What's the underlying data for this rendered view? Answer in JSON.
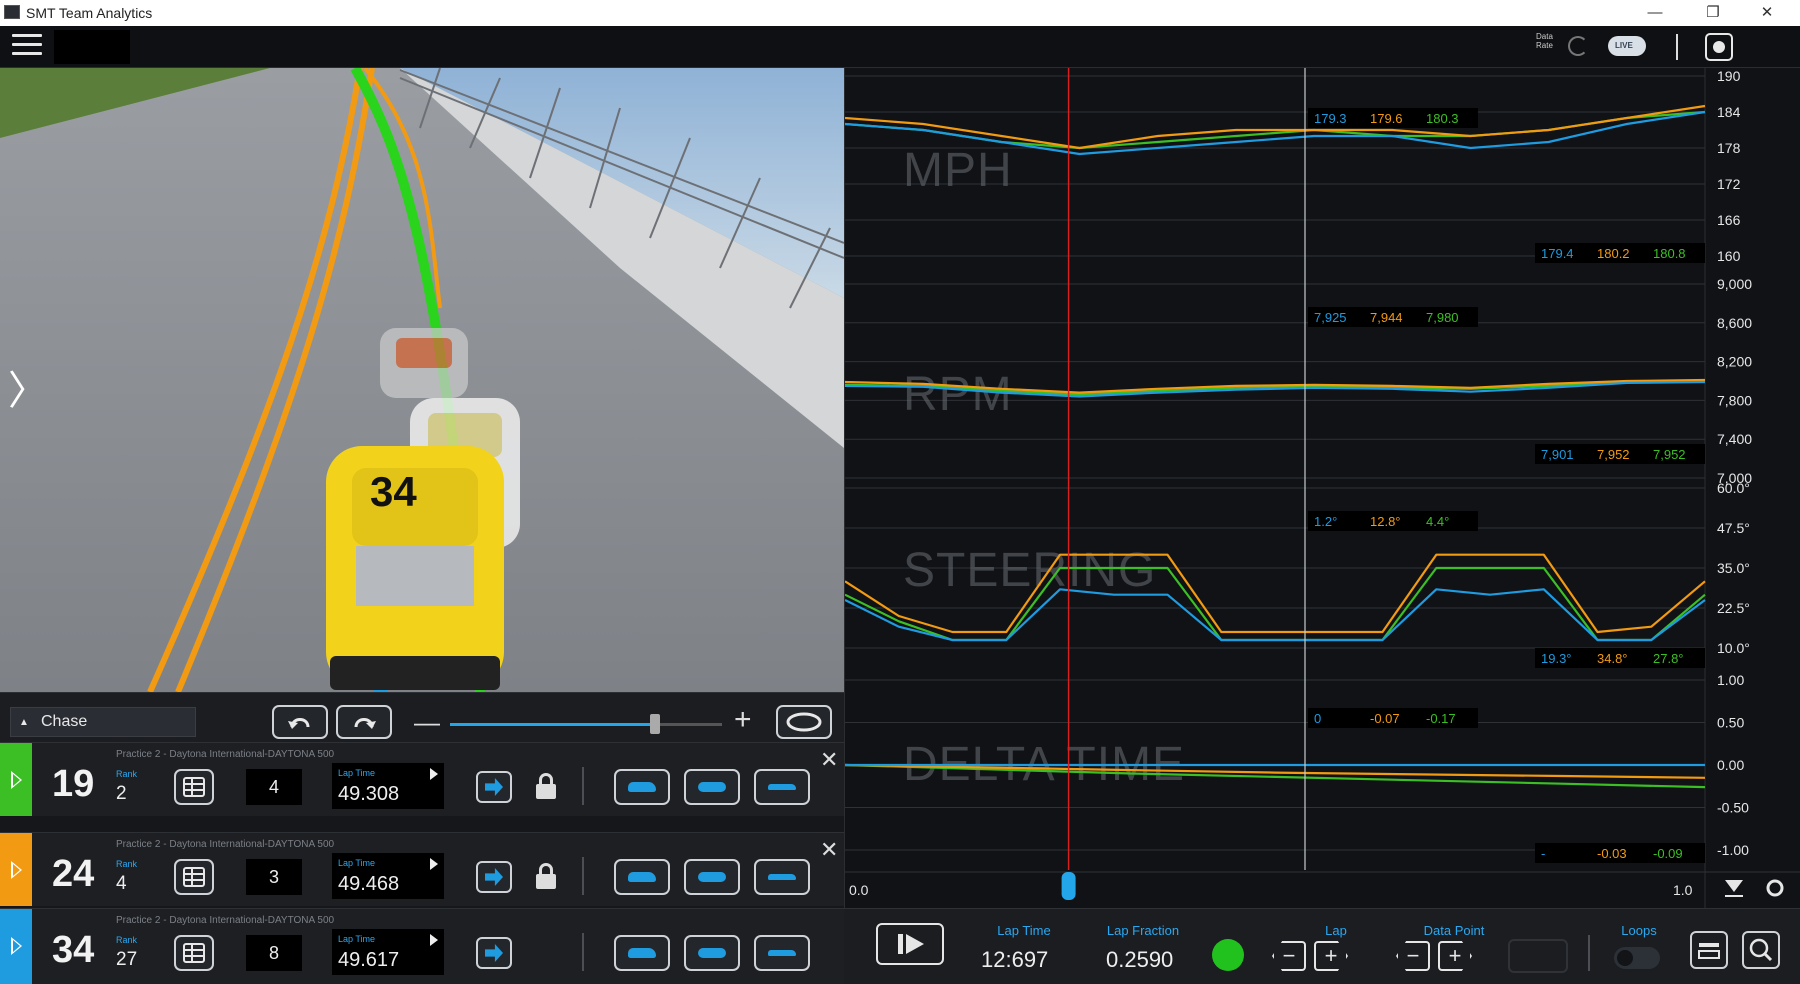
{
  "window": {
    "title": "SMT Team Analytics",
    "minimize": "—",
    "maximize": "❐",
    "close": "✕"
  },
  "toolbar": {
    "data_rate": "Data Rate",
    "cloud_label": "LIVE"
  },
  "camera": {
    "mode": "Chase",
    "zoom_minus": "—",
    "zoom_plus": "+"
  },
  "sessions": [
    {
      "car": "19",
      "rank_label": "Rank",
      "rank": "2",
      "session": "Practice 2 - Daytona International-DAYTONA 500",
      "lap": "4",
      "lap_time_label": "Lap Time",
      "lap_time": "49.308",
      "color": "#3cbf25",
      "closable": true,
      "locked": true
    },
    {
      "car": "24",
      "rank_label": "Rank",
      "rank": "4",
      "session": "Practice 2 - Daytona International-DAYTONA 500",
      "lap": "3",
      "lap_time_label": "Lap Time",
      "lap_time": "49.468",
      "color": "#f29a12",
      "closable": true,
      "locked": true
    },
    {
      "car": "34",
      "rank_label": "Rank",
      "rank": "27",
      "session": "Practice 2 - Daytona International-DAYTONA 500",
      "lap": "8",
      "lap_time_label": "Lap Time",
      "lap_time": "49.617",
      "color": "#1f9be0",
      "closable": false,
      "locked": false
    }
  ],
  "chart_data": {
    "type": "line",
    "x_range": [
      0.0,
      1.0
    ],
    "x_start_label": "0.0",
    "x_end_label": "1.0",
    "cursor_x": 0.26,
    "series_colors": [
      "#3cbf25",
      "#f29a12",
      "#1f9be0"
    ],
    "panels": [
      {
        "title": "MPH",
        "yticks": [
          "190",
          "184",
          "178",
          "172",
          "166",
          "160"
        ],
        "ylim": [
          160,
          190
        ],
        "readout_top": [
          "179.3",
          "179.6",
          "180.3"
        ],
        "readout_bottom": [
          "179.4",
          "180.2",
          "180.8"
        ],
        "values_green": [
          182,
          181,
          179,
          178,
          179,
          180,
          181,
          180,
          180,
          181,
          183,
          184
        ],
        "values_orange": [
          183,
          182,
          180,
          178,
          180,
          181,
          181,
          181,
          180,
          181,
          183,
          185
        ],
        "values_blue": [
          182,
          181,
          179,
          177,
          178,
          179,
          180,
          180,
          178,
          179,
          182,
          184
        ]
      },
      {
        "title": "RPM",
        "yticks": [
          "9,000",
          "8,600",
          "8,200",
          "7,800",
          "7,400",
          "7,000"
        ],
        "ylim": [
          7000,
          9000
        ],
        "readout_top": [
          "7,925",
          "7,944",
          "7,980"
        ],
        "readout_bottom": [
          "7,901",
          "7,952",
          "7,952"
        ],
        "values_green": [
          7960,
          7950,
          7900,
          7860,
          7900,
          7930,
          7950,
          7930,
          7920,
          7950,
          7990,
          8000
        ],
        "values_orange": [
          7990,
          7970,
          7920,
          7880,
          7920,
          7950,
          7960,
          7950,
          7930,
          7970,
          8000,
          8010
        ],
        "values_blue": [
          7950,
          7940,
          7880,
          7840,
          7880,
          7910,
          7930,
          7920,
          7890,
          7930,
          7980,
          7990
        ]
      },
      {
        "title": "STEERING",
        "yticks": [
          "60.0°",
          "47.5°",
          "35.0°",
          "22.5°",
          "10.0°"
        ],
        "ylim": [
          0,
          60
        ],
        "readout_top": [
          "1.2°",
          "12.8°",
          "4.4°"
        ],
        "readout_bottom": [
          "19.3°",
          "34.8°",
          "27.8°"
        ],
        "values_green": [
          20,
          10,
          3,
          3,
          30,
          30,
          30,
          3,
          3,
          3,
          3,
          30,
          30,
          30,
          3,
          3,
          20
        ],
        "values_orange": [
          25,
          12,
          6,
          6,
          35,
          35,
          35,
          6,
          6,
          6,
          6,
          35,
          35,
          35,
          6,
          8,
          25
        ],
        "values_blue": [
          18,
          8,
          3,
          3,
          22,
          20,
          20,
          3,
          3,
          3,
          3,
          22,
          20,
          22,
          3,
          3,
          18
        ]
      },
      {
        "title": "DELTA TIME",
        "yticks": [
          "1.00",
          "0.50",
          "0.00",
          "-0.50",
          "-1.00"
        ],
        "ylim": [
          -1.0,
          1.0
        ],
        "readout_top": [
          "0",
          "-0.07",
          "-0.17"
        ],
        "readout_bottom": [
          "-",
          "-0.03",
          "-0.09"
        ],
        "values_green": [
          0.0,
          -0.05,
          -0.1,
          -0.14,
          -0.18,
          -0.22,
          -0.26
        ],
        "values_orange": [
          0.0,
          -0.03,
          -0.06,
          -0.09,
          -0.11,
          -0.13,
          -0.15
        ],
        "values_blue": [
          0.0,
          0.0,
          0.0,
          0.0,
          0.0,
          0.0,
          0.0
        ]
      }
    ]
  },
  "bottom": {
    "lap_time_label": "Lap Time",
    "lap_time": "12:697",
    "lap_fraction_label": "Lap Fraction",
    "lap_fraction": "0.2590",
    "lap_label": "Lap",
    "data_point_label": "Data Point",
    "loops_label": "Loops",
    "minus": "−",
    "plus": "+"
  }
}
